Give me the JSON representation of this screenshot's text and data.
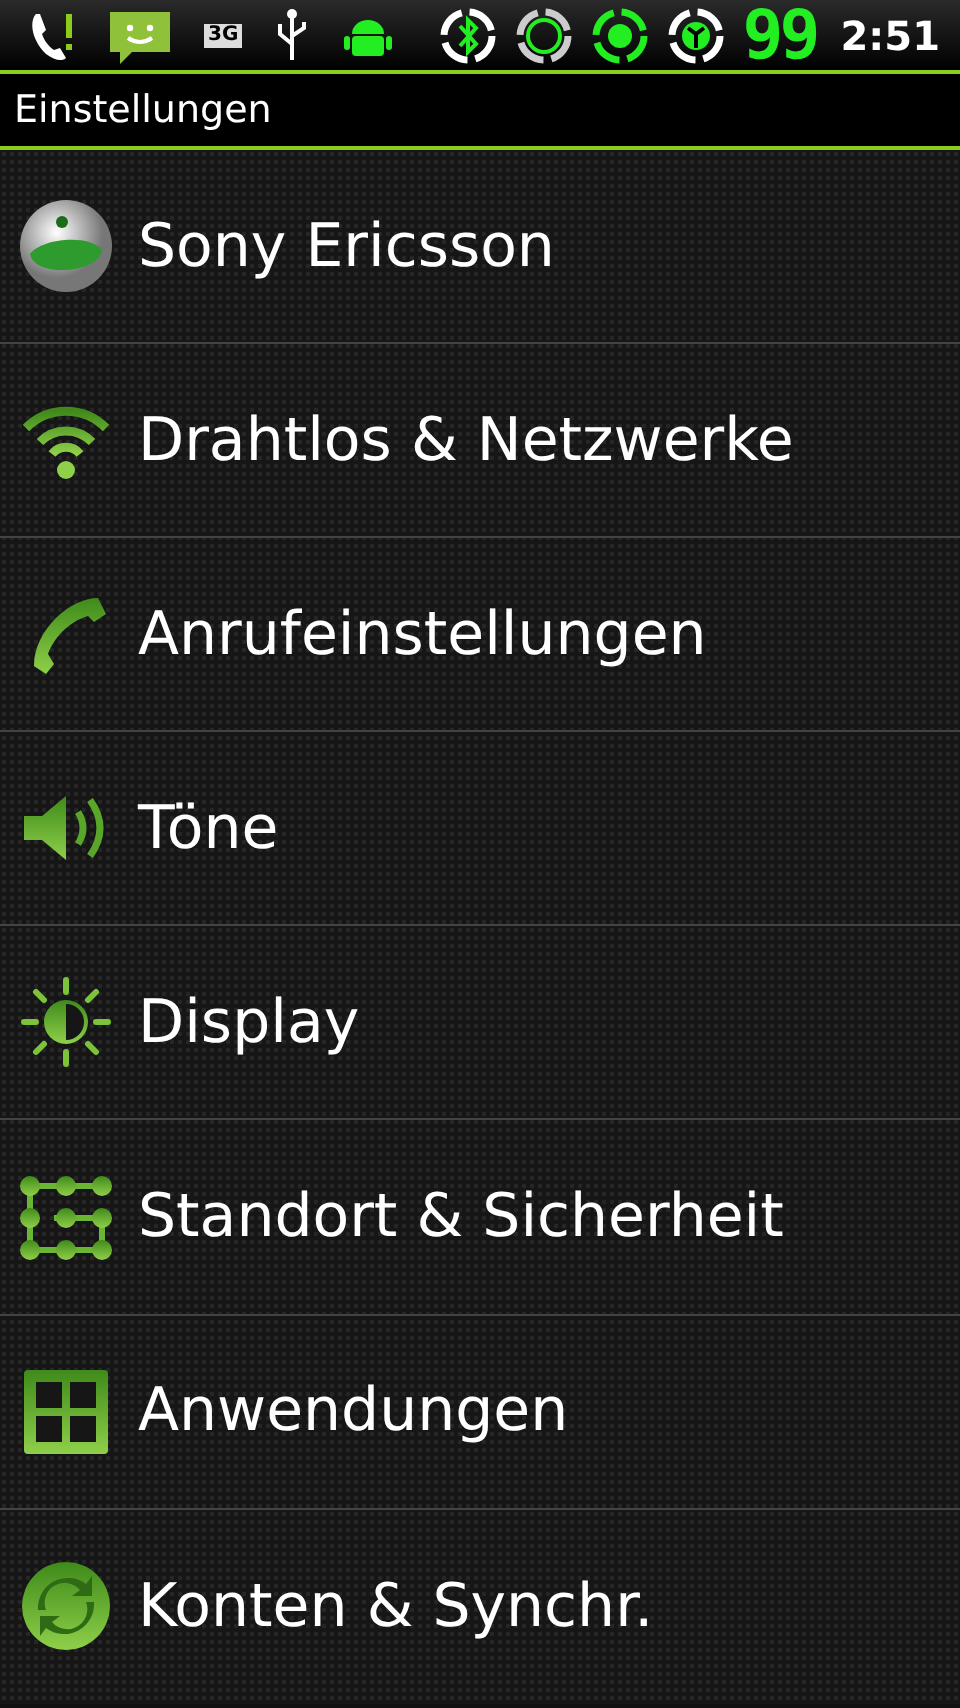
{
  "status_bar": {
    "network_label": "3G",
    "battery": "99",
    "time": "2:51"
  },
  "title": "Einstellungen",
  "items": [
    {
      "kind": "logo",
      "label": "Sony Ericsson"
    },
    {
      "kind": "wireless",
      "label": "Drahtlos & Netzwerke"
    },
    {
      "kind": "call",
      "label": "Anrufeinstellungen"
    },
    {
      "kind": "sound",
      "label": "Töne"
    },
    {
      "kind": "display",
      "label": "Display"
    },
    {
      "kind": "location",
      "label": "Standort & Sicherheit"
    },
    {
      "kind": "apps",
      "label": "Anwendungen"
    },
    {
      "kind": "sync",
      "label": "Konten & Synchr."
    }
  ]
}
